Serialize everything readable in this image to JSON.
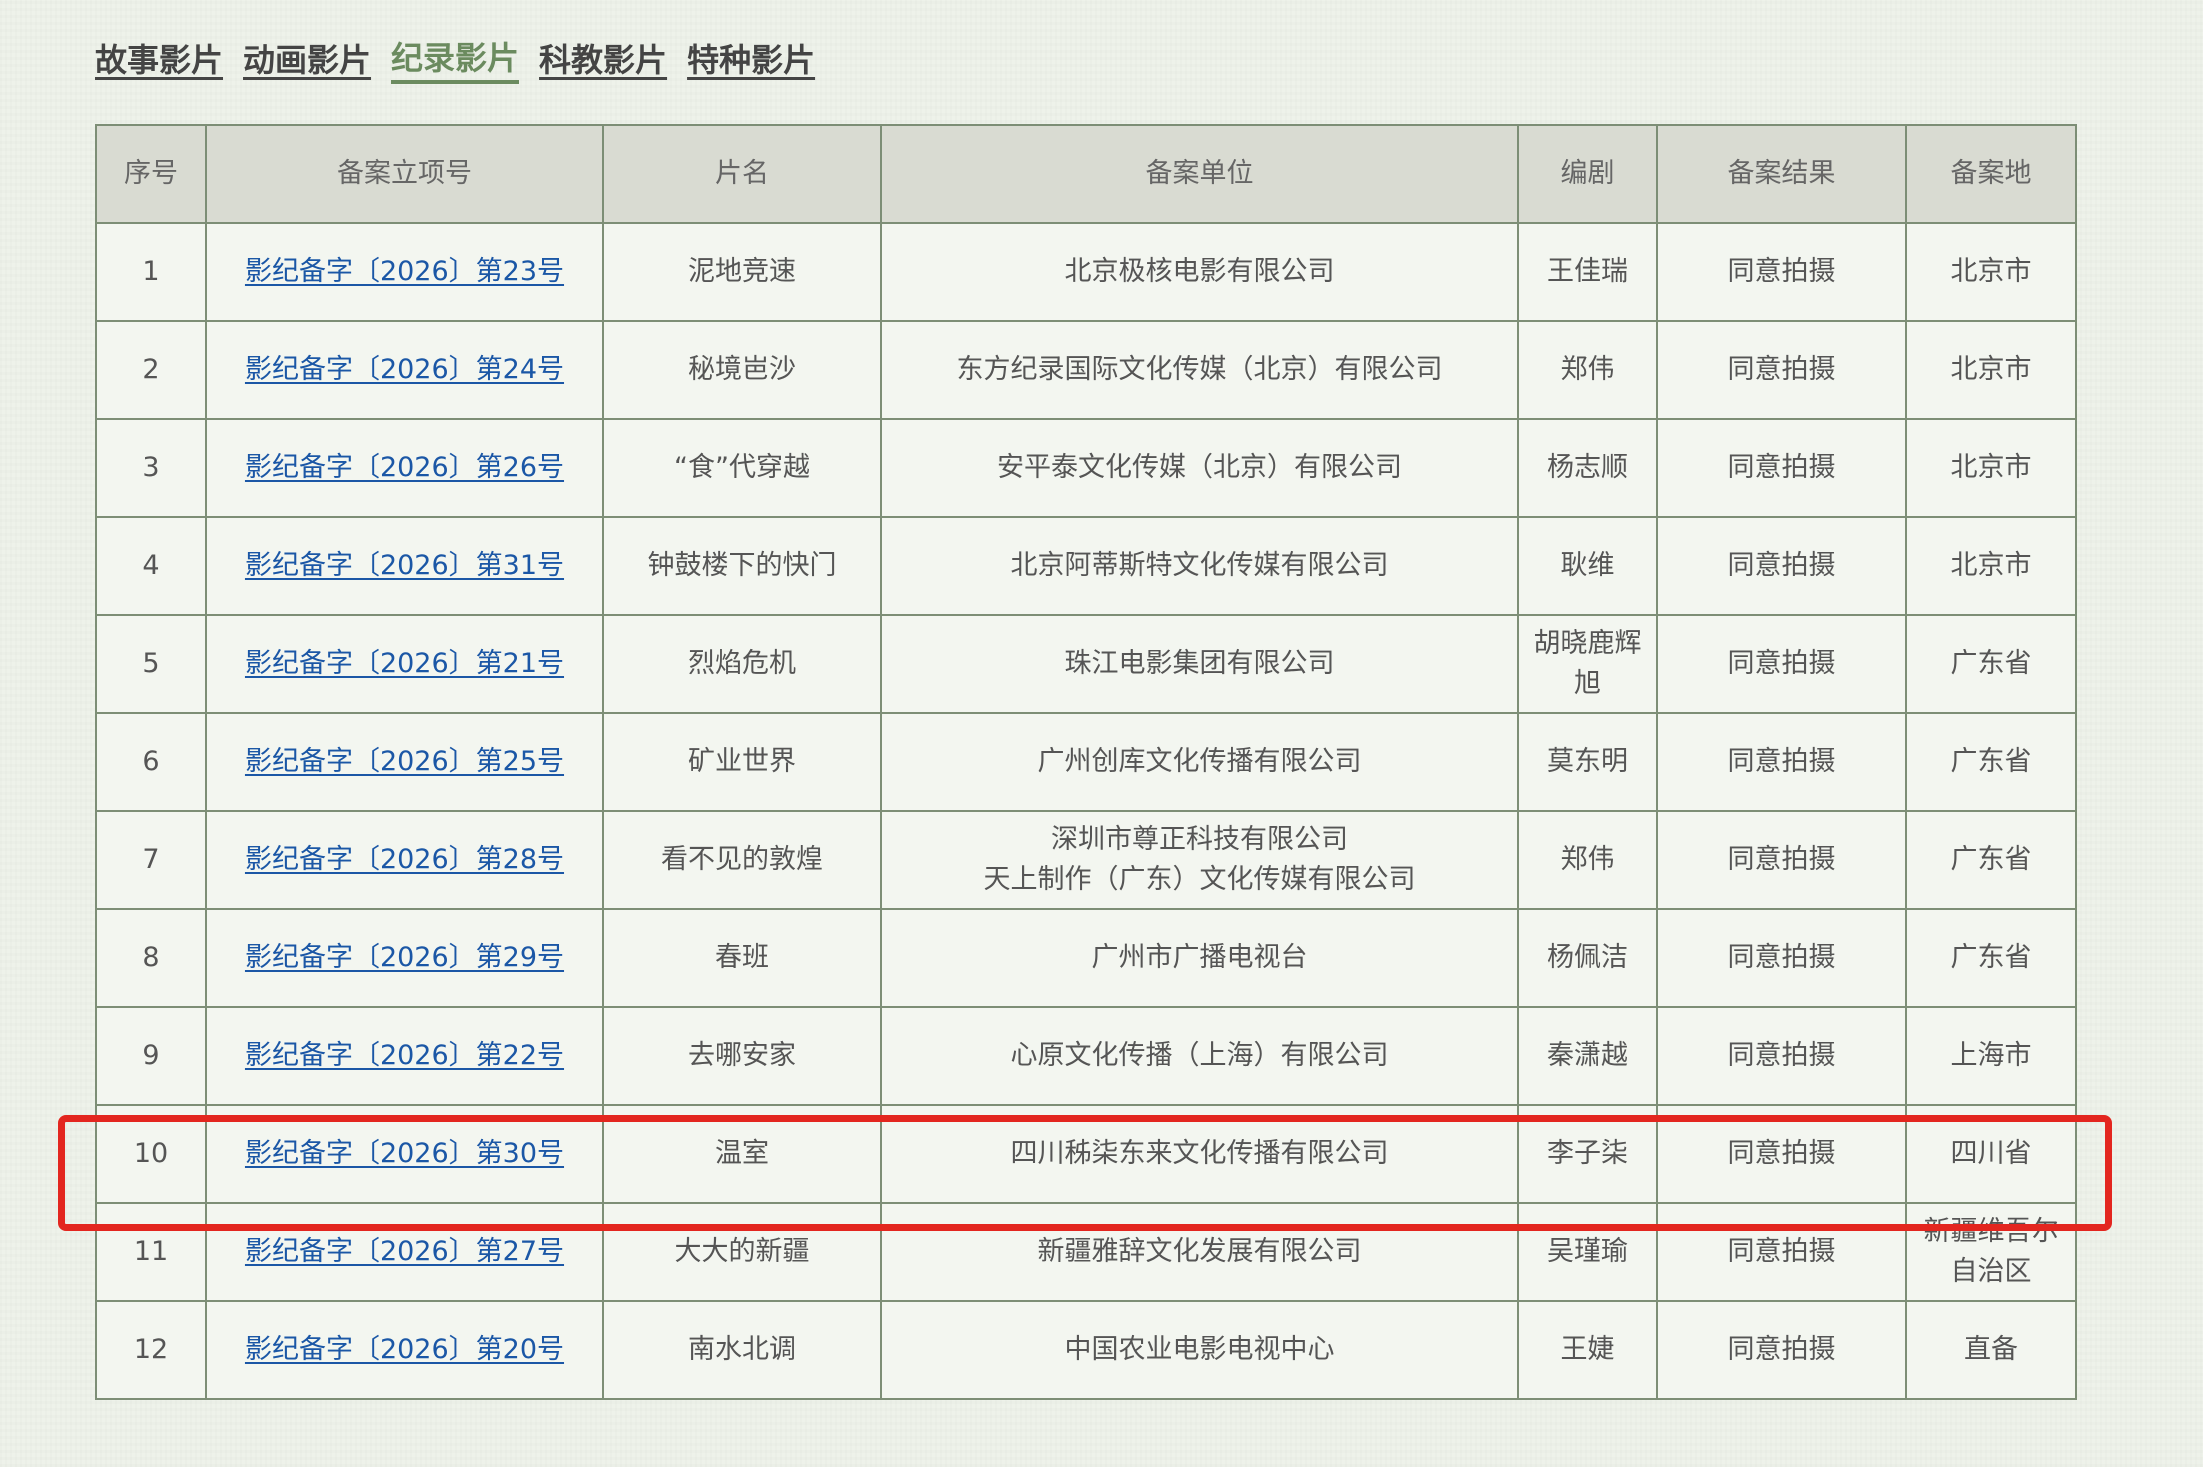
{
  "tabs": [
    {
      "label": "故事影片",
      "active": false
    },
    {
      "label": "动画影片",
      "active": false
    },
    {
      "label": "纪录影片",
      "active": true
    },
    {
      "label": "科教影片",
      "active": false
    },
    {
      "label": "特种影片",
      "active": false
    }
  ],
  "table": {
    "headers": [
      "序号",
      "备案立项号",
      "片名",
      "备案单位",
      "编剧",
      "备案结果",
      "备案地"
    ],
    "rows": [
      {
        "no": "1",
        "filing": "影纪备字〔2026〕第23号",
        "title": "泥地竞速",
        "unit": "北京极核电影有限公司",
        "writer": "王佳瑞",
        "result": "同意拍摄",
        "location": "北京市"
      },
      {
        "no": "2",
        "filing": "影纪备字〔2026〕第24号",
        "title": "秘境岜沙",
        "unit": "东方纪录国际文化传媒（北京）有限公司",
        "writer": "郑伟",
        "result": "同意拍摄",
        "location": "北京市"
      },
      {
        "no": "3",
        "filing": "影纪备字〔2026〕第26号",
        "title": "“食”代穿越",
        "unit": "安平泰文化传媒（北京）有限公司",
        "writer": "杨志顺",
        "result": "同意拍摄",
        "location": "北京市"
      },
      {
        "no": "4",
        "filing": "影纪备字〔2026〕第31号",
        "title": "钟鼓楼下的快门",
        "unit": "北京阿蒂斯特文化传媒有限公司",
        "writer": "耿维",
        "result": "同意拍摄",
        "location": "北京市"
      },
      {
        "no": "5",
        "filing": "影纪备字〔2026〕第21号",
        "title": "烈焰危机",
        "unit": "珠江电影集团有限公司",
        "writer": "胡晓鹿辉旭",
        "result": "同意拍摄",
        "location": "广东省"
      },
      {
        "no": "6",
        "filing": "影纪备字〔2026〕第25号",
        "title": "矿业世界",
        "unit": "广州创库文化传播有限公司",
        "writer": "莫东明",
        "result": "同意拍摄",
        "location": "广东省"
      },
      {
        "no": "7",
        "filing": "影纪备字〔2026〕第28号",
        "title": "看不见的敦煌",
        "unit": "深圳市尊正科技有限公司\n天上制作（广东）文化传媒有限公司",
        "writer": "郑伟",
        "result": "同意拍摄",
        "location": "广东省"
      },
      {
        "no": "8",
        "filing": "影纪备字〔2026〕第29号",
        "title": "春班",
        "unit": "广州市广播电视台",
        "writer": "杨佩洁",
        "result": "同意拍摄",
        "location": "广东省"
      },
      {
        "no": "9",
        "filing": "影纪备字〔2026〕第22号",
        "title": "去哪安家",
        "unit": "心原文化传播（上海）有限公司",
        "writer": "秦潇越",
        "result": "同意拍摄",
        "location": "上海市"
      },
      {
        "no": "10",
        "filing": "影纪备字〔2026〕第30号",
        "title": "温室",
        "unit": "四川秭柒东来文化传播有限公司",
        "writer": "李子柒",
        "result": "同意拍摄",
        "location": "四川省"
      },
      {
        "no": "11",
        "filing": "影纪备字〔2026〕第27号",
        "title": "大大的新疆",
        "unit": "新疆雅辞文化发展有限公司",
        "writer": "吴瑾瑜",
        "result": "同意拍摄",
        "location": "新疆维吾尔自治区"
      },
      {
        "no": "12",
        "filing": "影纪备字〔2026〕第20号",
        "title": "南水北调",
        "unit": "中国农业电影电视中心",
        "writer": "王婕",
        "result": "同意拍摄",
        "location": "直备"
      }
    ]
  },
  "highlight": {
    "row_no": "10",
    "color": "#e3261f"
  },
  "colors": {
    "link": "#1b57a6",
    "active_tab": "#6b8b5f",
    "header_bg": "#d9dbd2",
    "border": "#7d8e76"
  }
}
